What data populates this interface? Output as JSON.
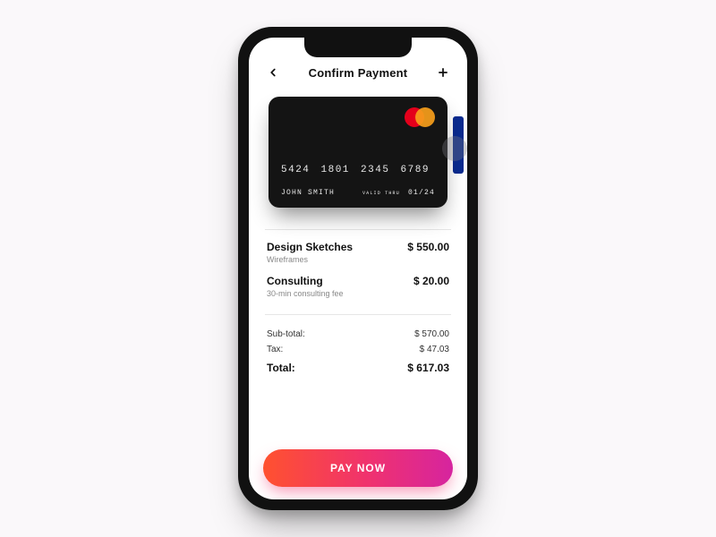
{
  "header": {
    "title": "Confirm Payment"
  },
  "card": {
    "number": "5424 1801 2345 6789",
    "name": "JOHN SMITH",
    "valid_label": "VALID\nTHRU",
    "expiry": "01/24"
  },
  "items": [
    {
      "name": "Design Sketches",
      "sub": "Wireframes",
      "price": "$ 550.00"
    },
    {
      "name": "Consulting",
      "sub": "30-min consulting fee",
      "price": "$ 20.00"
    }
  ],
  "totals": {
    "sub_label": "Sub-total:",
    "sub_value": "$ 570.00",
    "tax_label": "Tax:",
    "tax_value": "$ 47.03",
    "total_label": "Total:",
    "total_value": "$ 617.03"
  },
  "actions": {
    "pay_label": "PAY NOW"
  }
}
